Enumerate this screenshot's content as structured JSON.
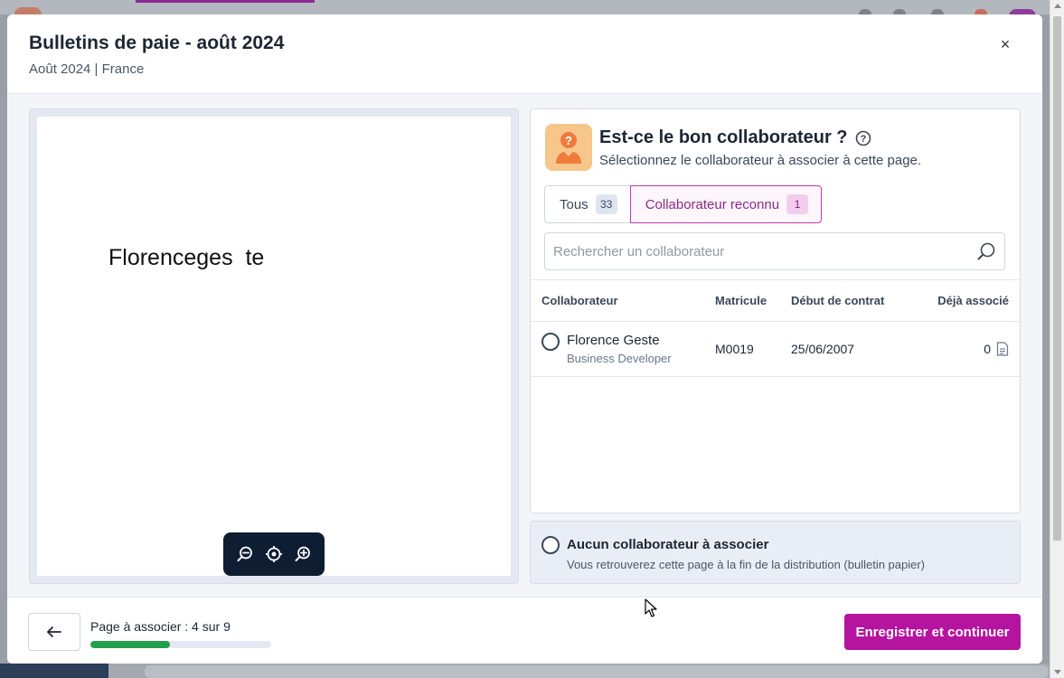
{
  "modal": {
    "title": "Bulletins de paie - août 2024",
    "subtitle": "Août 2024 | France",
    "close_label": "×"
  },
  "preview": {
    "text": "Florenceges  te"
  },
  "panel": {
    "title": "Est-ce le bon collaborateur ?",
    "description": "Sélectionnez le collaborateur à associer à cette page.",
    "tabs": [
      {
        "label": "Tous",
        "count": "33"
      },
      {
        "label": "Collaborateur reconnu",
        "count": "1"
      }
    ],
    "search": {
      "placeholder": "Rechercher un collaborateur",
      "value": ""
    },
    "table": {
      "columns": [
        "Collaborateur",
        "Matricule",
        "Début de contrat",
        "Déjà associé"
      ],
      "rows": [
        {
          "name": "Florence Geste",
          "role": "Business Developer",
          "matricule": "M0019",
          "start_date": "25/06/2007",
          "associated": "0"
        }
      ]
    },
    "none_option": {
      "title": "Aucun collaborateur à associer",
      "description": "Vous retrouverez cette page à la fin de la distribution (bulletin papier)"
    }
  },
  "footer": {
    "page_label": "Page à associer : 4 sur 9",
    "progress": 0.44,
    "save_label": "Enregistrer et continuer"
  },
  "colors": {
    "accent": "#b5149e",
    "progress": "#23a04a",
    "zoom_bar": "#0f1d33",
    "icon_bg": "#f7c68a"
  }
}
